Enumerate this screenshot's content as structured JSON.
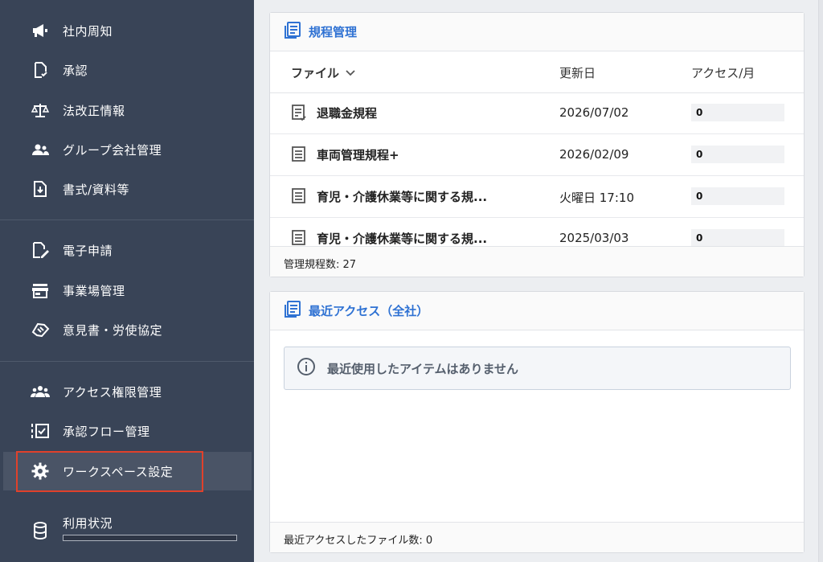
{
  "sidebar": {
    "items": [
      {
        "label": "社内周知",
        "icon": "megaphone-icon"
      },
      {
        "label": "承認",
        "icon": "document-check-icon"
      },
      {
        "label": "法改正情報",
        "icon": "scale-icon"
      },
      {
        "label": "グループ会社管理",
        "icon": "group-icon"
      },
      {
        "label": "書式/資料等",
        "icon": "document-download-icon"
      },
      {
        "label": "電子申請",
        "icon": "document-edit-icon"
      },
      {
        "label": "事業場管理",
        "icon": "store-icon"
      },
      {
        "label": "意見書・労使協定",
        "icon": "handshake-icon"
      },
      {
        "label": "アクセス権限管理",
        "icon": "people-icon"
      },
      {
        "label": "承認フロー管理",
        "icon": "checklist-icon"
      },
      {
        "label": "ワークスペース設定",
        "icon": "gear-icon"
      },
      {
        "label": "利用状況",
        "icon": "database-icon"
      }
    ],
    "active_item": "ワークスペース設定"
  },
  "rules_card": {
    "title": "規程管理",
    "columns": {
      "file": "ファイル",
      "updated": "更新日",
      "access": "アクセス/月"
    },
    "rows": [
      {
        "name": "退職金規程",
        "date": "2026/07/02",
        "access": "0"
      },
      {
        "name": "車両管理規程+",
        "date": "2026/02/09",
        "access": "0"
      },
      {
        "name": "育児・介護休業等に関する規...",
        "date": "火曜日 17:10",
        "access": "0"
      },
      {
        "name": "育児・介護休業等に関する規...",
        "date": "2025/03/03",
        "access": "0"
      }
    ],
    "footer": "管理規程数: 27"
  },
  "recent_card": {
    "title": "最近アクセス（全社）",
    "empty_message": "最近使用したアイテムはありません",
    "footer": "最近アクセスしたファイル数: 0"
  },
  "colors": {
    "sidebar": "#394457",
    "accent": "#2f72d3",
    "highlight": "#e0412b"
  }
}
